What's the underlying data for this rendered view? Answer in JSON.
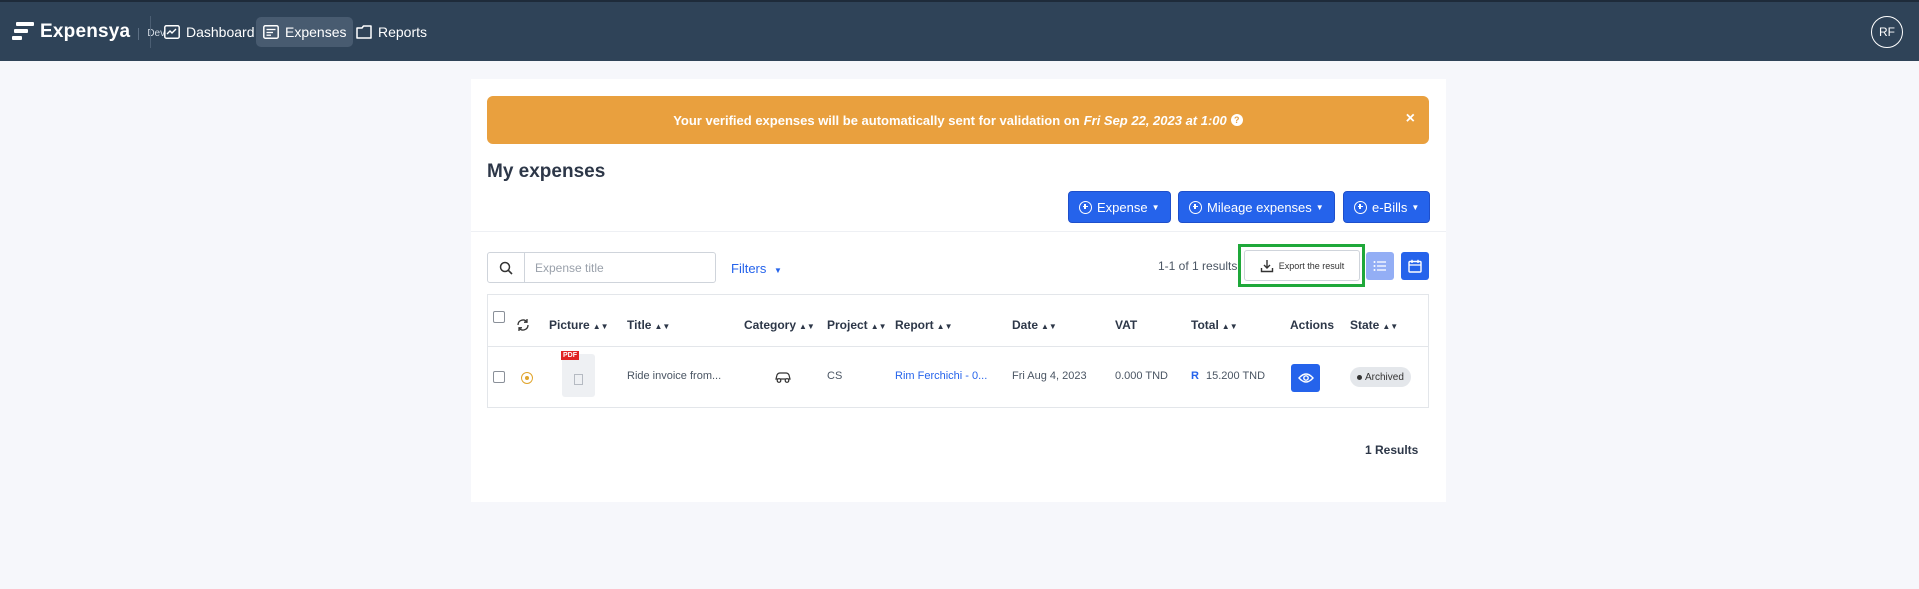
{
  "app": {
    "name": "Expensya",
    "env": "Dev"
  },
  "nav": {
    "items": [
      {
        "label": "Dashboard",
        "icon": "dashboard-icon"
      },
      {
        "label": "Expenses",
        "icon": "expenses-icon",
        "active": true
      },
      {
        "label": "Reports",
        "icon": "reports-icon"
      }
    ],
    "avatar": "RF"
  },
  "banner": {
    "text": "Your verified expenses will be automatically sent for validation on",
    "date": "Fri Sep 22, 2023 at 1:00",
    "close": "×",
    "color": "#e9a03e"
  },
  "page": {
    "title": "My expenses"
  },
  "actions": {
    "expense": "Expense",
    "mileage": "Mileage expenses",
    "ebills": "e-Bills"
  },
  "search": {
    "placeholder": "Expense title",
    "value": ""
  },
  "filters": {
    "label": "Filters"
  },
  "results": {
    "count_text": "1-1 of 1 results",
    "footer": "1 Results"
  },
  "export": {
    "label": "Export the result"
  },
  "table": {
    "columns": [
      "Picture",
      "Title",
      "Category",
      "Project",
      "Report",
      "Date",
      "VAT",
      "Total",
      "Actions",
      "State"
    ],
    "rows": [
      {
        "pdf": "PDF",
        "title": "Ride invoice from...",
        "category_icon": "car-icon",
        "project": "CS",
        "report": "Rim Ferchichi - 0...",
        "date": "Fri Aug 4, 2023",
        "vat": "0.000 TND",
        "total_mark": "R",
        "total": "15.200 TND",
        "state": "Archived"
      }
    ]
  },
  "colors": {
    "nav_bg": "#2f4358",
    "primary": "#2563eb",
    "highlight": "#1fa83a"
  }
}
